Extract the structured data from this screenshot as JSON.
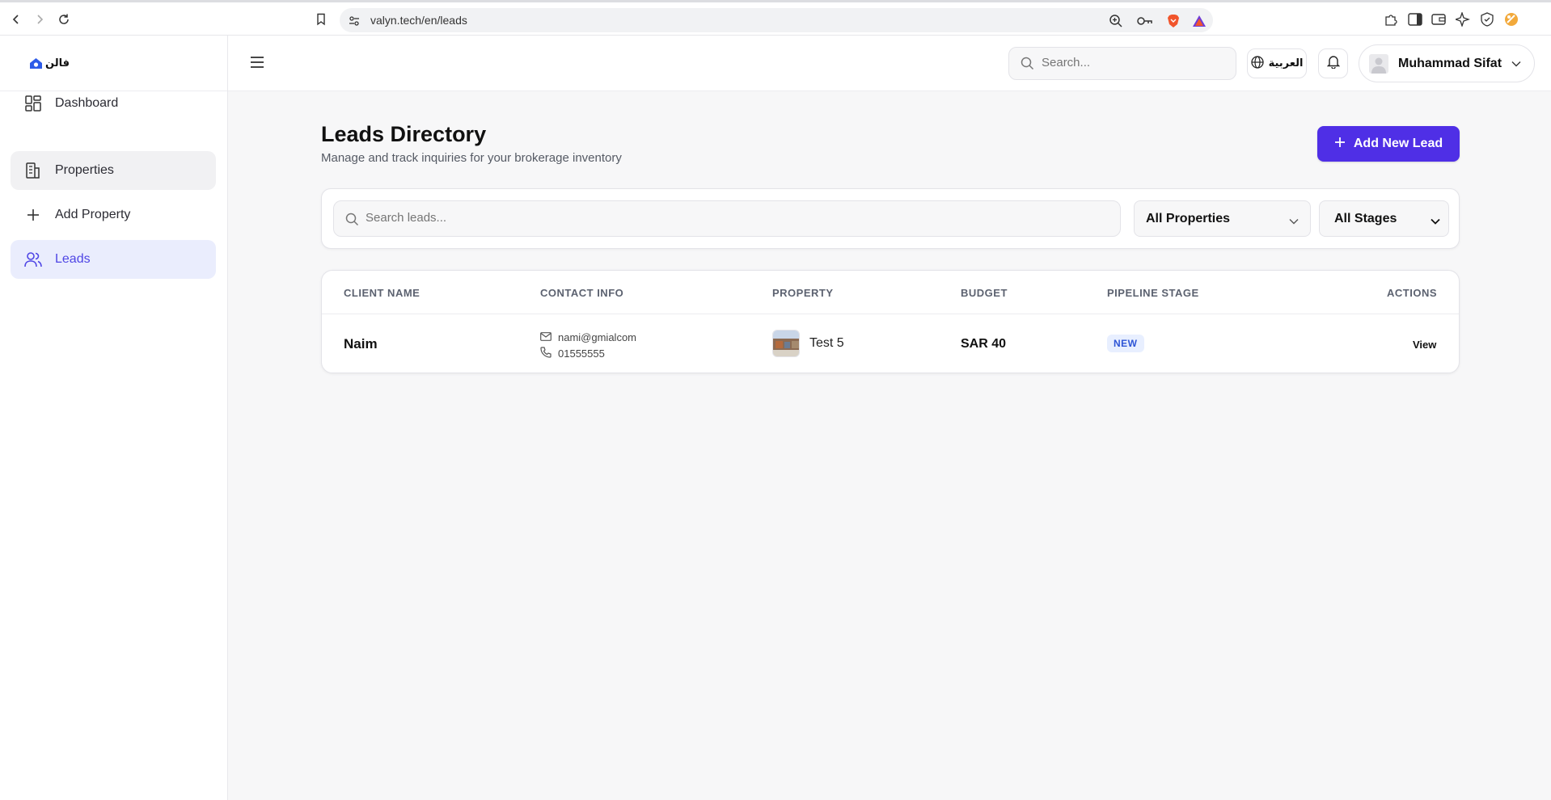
{
  "browser": {
    "url": "valyn.tech/en/leads"
  },
  "sidebar": {
    "logo_text": "فالن",
    "items": [
      {
        "label": "Dashboard",
        "icon": "dashboard-icon"
      },
      {
        "label": "Properties",
        "icon": "building-icon"
      },
      {
        "label": "Add Property",
        "icon": "plus-icon"
      },
      {
        "label": "Leads",
        "icon": "users-icon"
      }
    ]
  },
  "header": {
    "search_placeholder": "Search...",
    "language_label": "العربية",
    "user_name": "Muhammad Sifat"
  },
  "main": {
    "title": "Leads Directory",
    "subtitle": "Manage and track inquiries for your brokerage inventory",
    "add_button_label": "Add New Lead",
    "filters": {
      "search_placeholder": "Search leads...",
      "property_selected": "All Properties",
      "stage_selected": "All Stages"
    },
    "table": {
      "columns": [
        "CLIENT NAME",
        "CONTACT INFO",
        "PROPERTY",
        "BUDGET",
        "PIPELINE STAGE",
        "ACTIONS"
      ],
      "rows": [
        {
          "client_name": "Naim",
          "email": "nami@gmialcom",
          "phone": "01555555",
          "property": "Test 5",
          "budget": "SAR 40",
          "stage": "NEW",
          "action": "View"
        }
      ]
    }
  },
  "colors": {
    "accent": "#4f2fe6",
    "active_nav_bg": "#eaedfd",
    "active_nav_text": "#4f46e5",
    "badge_bg": "#e8efff",
    "badge_text": "#2e55d6"
  }
}
